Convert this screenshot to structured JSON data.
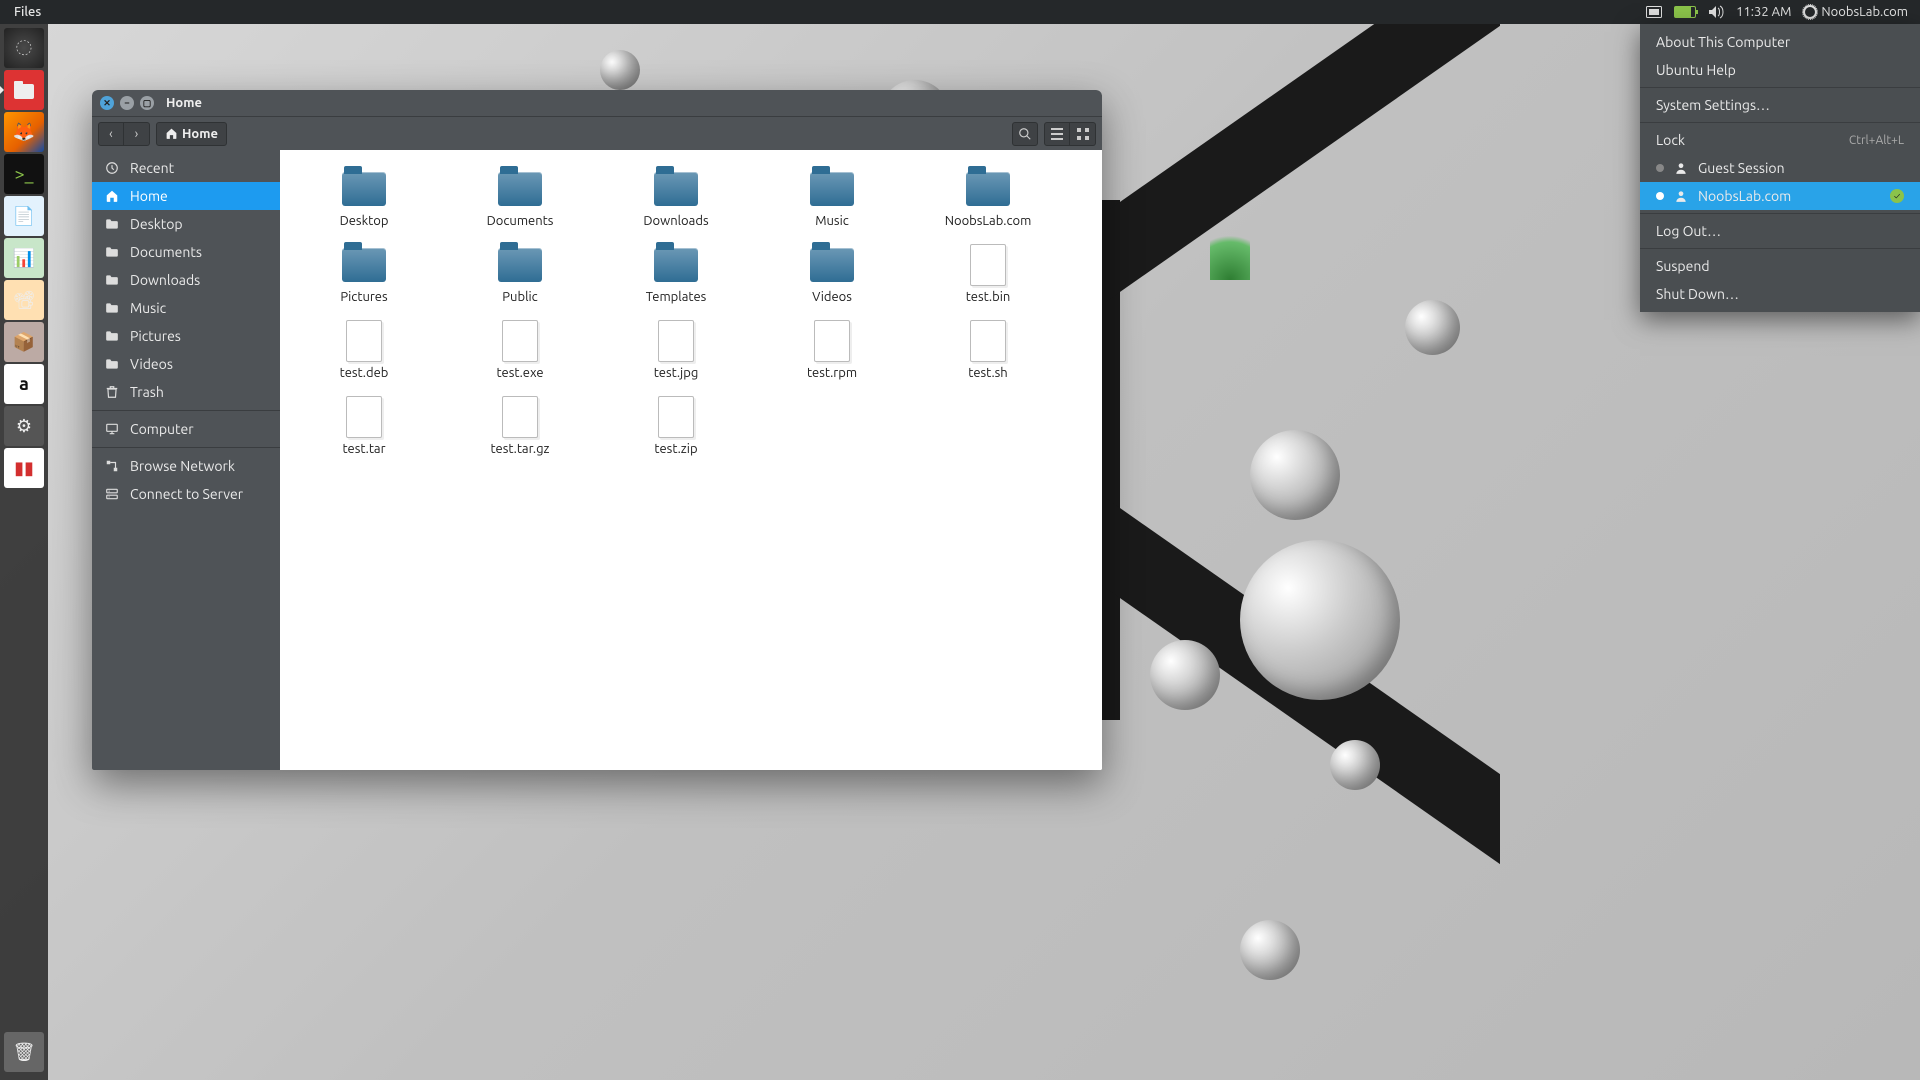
{
  "panel": {
    "app_menu": "Files",
    "time": "11:32 AM",
    "user": "NoobsLab.com"
  },
  "launcher": {
    "items": [
      "Dash",
      "Files",
      "Firefox",
      "Terminal",
      "Writer",
      "Calc",
      "Impress",
      "Software",
      "Amazon",
      "Settings",
      "Updates"
    ]
  },
  "fm": {
    "title": "Home",
    "path": "Home",
    "sidebar": [
      {
        "label": "Recent",
        "icon": "clock"
      },
      {
        "label": "Home",
        "icon": "home",
        "selected": true
      },
      {
        "label": "Desktop",
        "icon": "folder"
      },
      {
        "label": "Documents",
        "icon": "folder"
      },
      {
        "label": "Downloads",
        "icon": "folder"
      },
      {
        "label": "Music",
        "icon": "folder"
      },
      {
        "label": "Pictures",
        "icon": "folder"
      },
      {
        "label": "Videos",
        "icon": "folder"
      },
      {
        "label": "Trash",
        "icon": "trash"
      },
      {
        "sep": true
      },
      {
        "label": "Computer",
        "icon": "computer"
      },
      {
        "sep": true
      },
      {
        "label": "Browse Network",
        "icon": "network"
      },
      {
        "label": "Connect to Server",
        "icon": "server"
      }
    ],
    "files": [
      {
        "name": "Desktop",
        "type": "folder"
      },
      {
        "name": "Documents",
        "type": "folder"
      },
      {
        "name": "Downloads",
        "type": "folder"
      },
      {
        "name": "Music",
        "type": "folder"
      },
      {
        "name": "NoobsLab.com",
        "type": "folder"
      },
      {
        "name": "Pictures",
        "type": "folder"
      },
      {
        "name": "Public",
        "type": "folder"
      },
      {
        "name": "Templates",
        "type": "folder"
      },
      {
        "name": "Videos",
        "type": "folder"
      },
      {
        "name": "test.bin",
        "type": "file"
      },
      {
        "name": "test.deb",
        "type": "file"
      },
      {
        "name": "test.exe",
        "type": "file"
      },
      {
        "name": "test.jpg",
        "type": "file"
      },
      {
        "name": "test.rpm",
        "type": "file"
      },
      {
        "name": "test.sh",
        "type": "file"
      },
      {
        "name": "test.tar",
        "type": "file"
      },
      {
        "name": "test.tar.gz",
        "type": "file"
      },
      {
        "name": "test.zip",
        "type": "file"
      }
    ]
  },
  "sysmenu": [
    {
      "label": "About This Computer"
    },
    {
      "label": "Ubuntu Help"
    },
    {
      "sep": true
    },
    {
      "label": "System Settings…"
    },
    {
      "sep": true
    },
    {
      "label": "Lock",
      "shortcut": "Ctrl+Alt+L"
    },
    {
      "label": "Guest Session",
      "icon": "user",
      "radio": true
    },
    {
      "label": "NoobsLab.com",
      "icon": "user",
      "radio": true,
      "selected": true,
      "check": true
    },
    {
      "sep": true
    },
    {
      "label": "Log Out…"
    },
    {
      "sep": true
    },
    {
      "label": "Suspend"
    },
    {
      "label": "Shut Down…"
    }
  ]
}
